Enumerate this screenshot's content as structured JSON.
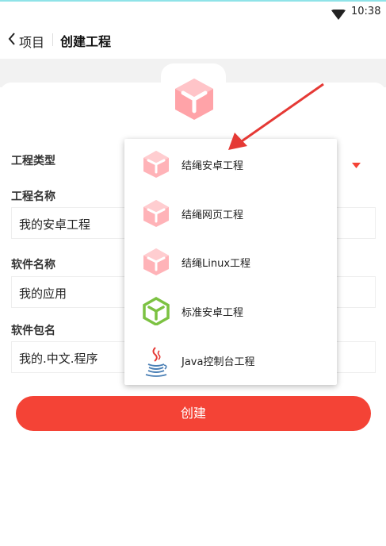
{
  "status_bar": {
    "time": "10:38"
  },
  "app_bar": {
    "back_label": "项目",
    "title": "创建工程"
  },
  "form": {
    "type_label": "工程类型",
    "name_label": "工程名称",
    "name_value": "我的安卓工程",
    "app_label": "软件名称",
    "app_value": "我的应用",
    "package_label": "软件包名",
    "package_value": "我的.中文.程序",
    "create_label": "创建"
  },
  "menu": {
    "items": [
      {
        "label": "结绳安卓工程",
        "icon": "cube-pink-icon"
      },
      {
        "label": "结绳网页工程",
        "icon": "cube-pink-icon"
      },
      {
        "label": "结绳Linux工程",
        "icon": "cube-pink-icon"
      },
      {
        "label": "标准安卓工程",
        "icon": "cube-green-icon"
      },
      {
        "label": "Java控制台工程",
        "icon": "java-cup-icon"
      }
    ]
  },
  "colors": {
    "accent": "#f44336",
    "arrow": "#e53935",
    "cube_pink": "#ffb3b8",
    "cube_green": "#7cc242"
  }
}
